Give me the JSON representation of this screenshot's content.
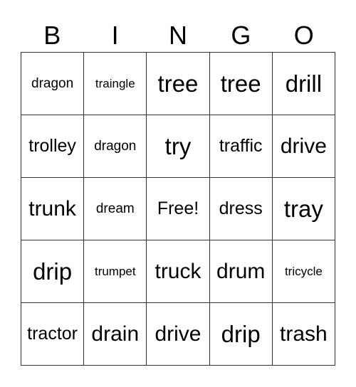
{
  "card": {
    "header": [
      "B",
      "I",
      "N",
      "G",
      "O"
    ],
    "rows": [
      [
        "dragon",
        "traingle",
        "tree",
        "tree",
        "drill"
      ],
      [
        "trolley",
        "dragon",
        "try",
        "traffic",
        "drive"
      ],
      [
        "trunk",
        "dream",
        "Free!",
        "dress",
        "tray"
      ],
      [
        "drip",
        "trumpet",
        "truck",
        "drum",
        "tricycle"
      ],
      [
        "tractor",
        "drain",
        "drive",
        "drip",
        "trash"
      ]
    ]
  }
}
